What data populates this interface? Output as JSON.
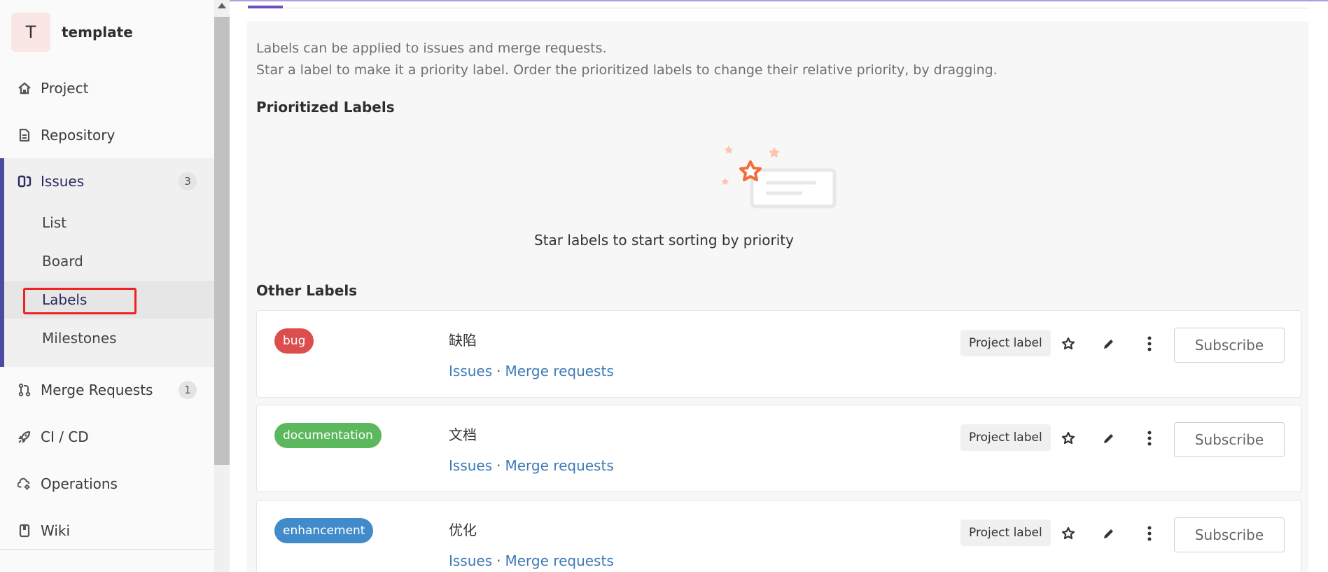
{
  "project": {
    "avatar_letter": "T",
    "name": "template"
  },
  "nav": {
    "project": "Project",
    "repository": "Repository",
    "issues": "Issues",
    "issues_count": "3",
    "list": "List",
    "board": "Board",
    "labels": "Labels",
    "milestones": "Milestones",
    "merge_requests": "Merge Requests",
    "merge_requests_count": "1",
    "cicd": "CI / CD",
    "operations": "Operations",
    "wiki": "Wiki"
  },
  "main": {
    "desc_line1": "Labels can be applied to issues and merge requests.",
    "desc_line2": "Star a label to make it a priority label. Order the prioritized labels to change their relative priority, by dragging.",
    "prioritized_title": "Prioritized Labels",
    "empty_text": "Star labels to start sorting by priority",
    "other_title": "Other Labels"
  },
  "labels": [
    {
      "name": "bug",
      "color": "#dc4d4d",
      "description": "缺陷",
      "issues_link": "Issues",
      "separator": "·",
      "mr_link": "Merge requests",
      "type": "Project label",
      "subscribe": "Subscribe"
    },
    {
      "name": "documentation",
      "color": "#5cb85c",
      "description": "文档",
      "issues_link": "Issues",
      "separator": "·",
      "mr_link": "Merge requests",
      "type": "Project label",
      "subscribe": "Subscribe"
    },
    {
      "name": "enhancement",
      "color": "#428bca",
      "description": "优化",
      "issues_link": "Issues",
      "separator": "·",
      "mr_link": "Merge requests",
      "type": "Project label",
      "subscribe": "Subscribe"
    }
  ],
  "colors": {
    "accent": "#6b4fbb",
    "active_nav": "#4b4ba3",
    "link": "#3d7ab8",
    "highlight_box": "#ee2222"
  },
  "icons": [
    "home-icon",
    "document-icon",
    "issues-icon",
    "merge-request-icon",
    "rocket-icon",
    "cloud-gear-icon",
    "book-icon",
    "star-outline-icon",
    "pencil-icon",
    "kebab-icon"
  ]
}
